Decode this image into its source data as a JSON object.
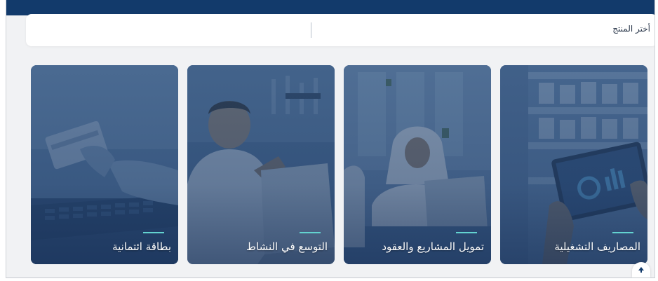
{
  "header": {
    "bar_color": "#123a6b"
  },
  "product_selector": {
    "label": "أختر المنتج"
  },
  "cards": [
    {
      "title": "بطاقة ائتمانية",
      "image": "credit-card-payment-photo"
    },
    {
      "title": "التوسع في النشاط",
      "image": "man-with-laptop-photo"
    },
    {
      "title": "تمويل المشاريع والعقود",
      "image": "business-meeting-photo"
    },
    {
      "title": "المصاريف التشغيلية",
      "image": "warehouse-tablet-photo"
    }
  ],
  "colors": {
    "accent": "#63d3d0",
    "card_overlay": "#2c4c76"
  },
  "scroll_top": {
    "icon": "arrow-up-icon"
  }
}
